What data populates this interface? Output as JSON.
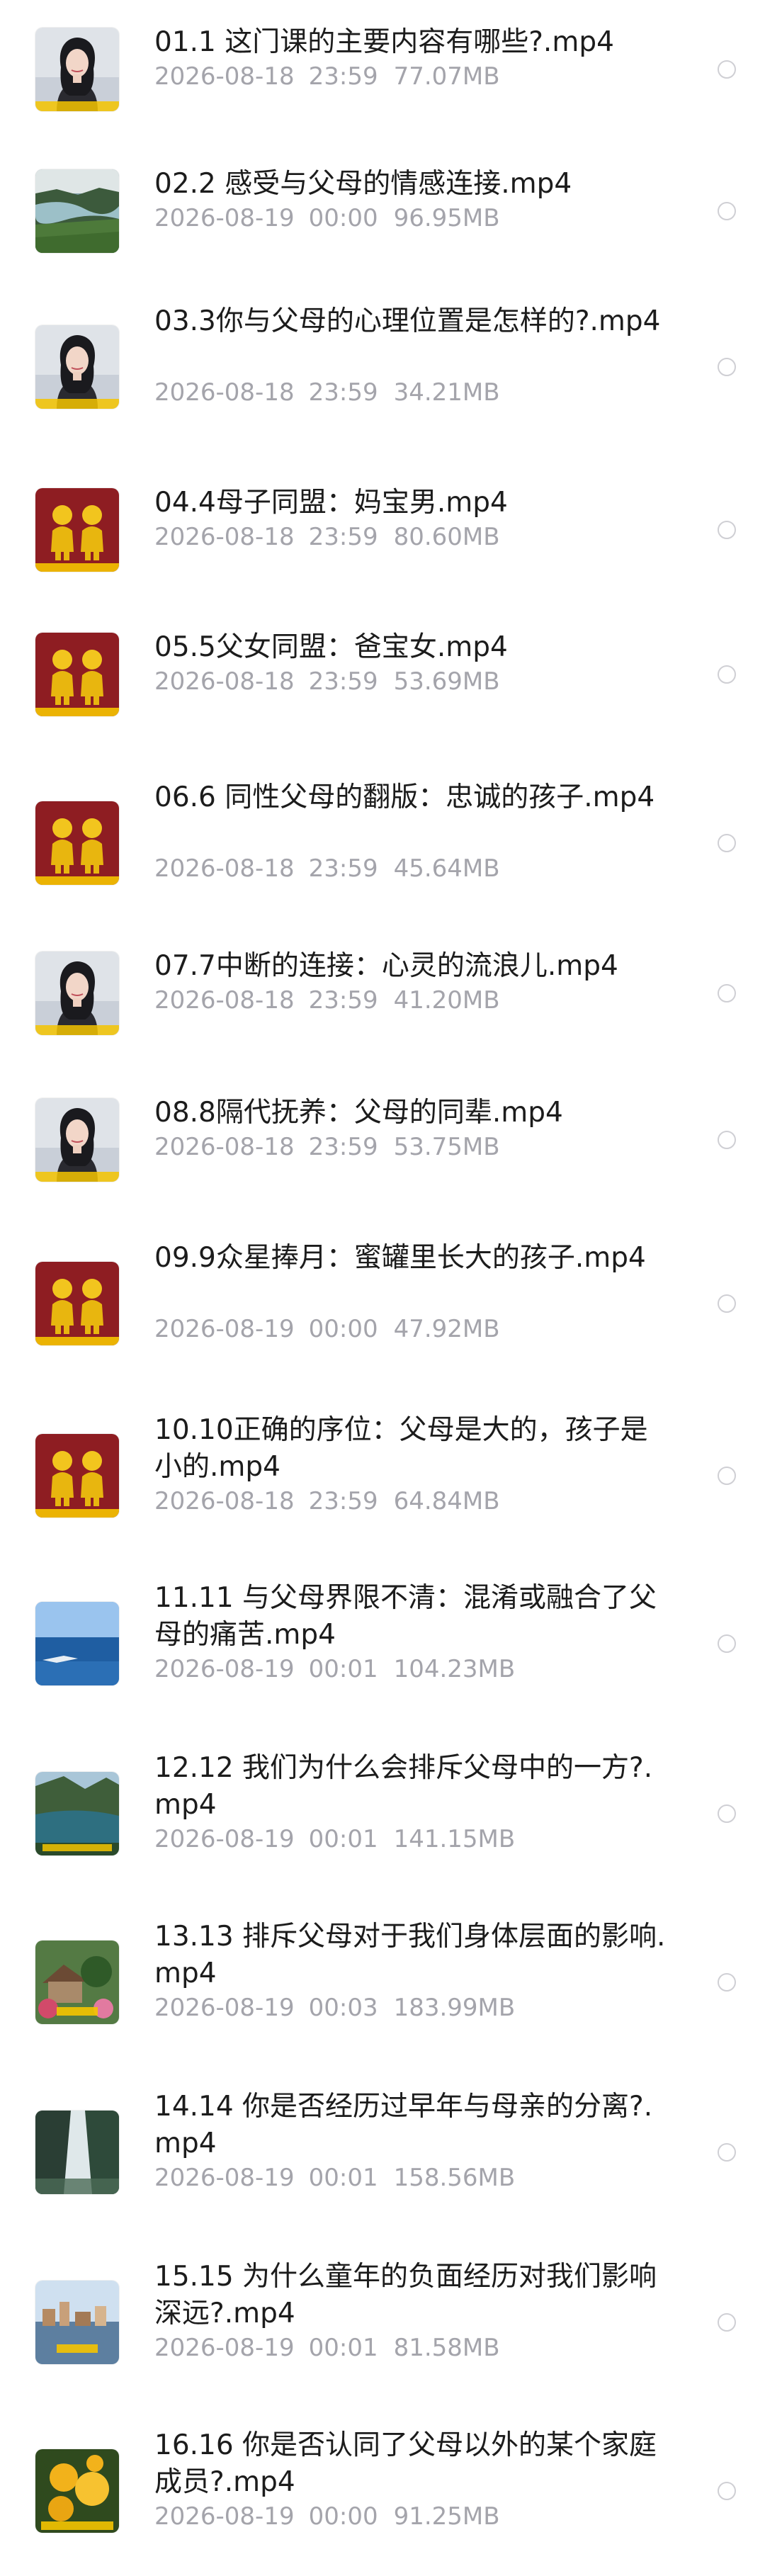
{
  "files": [
    {
      "name": "01.1 这门课的主要内容有哪些?.mp4",
      "date": "2026-08-18",
      "time": "23:59",
      "size": "77.07MB",
      "thumb": "woman-portrait-icon"
    },
    {
      "name": "02.2 感受与父母的情感连接.mp4",
      "date": "2026-08-19",
      "time": "00:00",
      "size": "96.95MB",
      "thumb": "landscape-icon"
    },
    {
      "name": "03.3你与父母的心理位置是怎样的?.mp4",
      "date": "2026-08-18",
      "time": "23:59",
      "size": "34.21MB",
      "thumb": "woman-portrait-icon"
    },
    {
      "name": "04.4母子同盟：妈宝男.mp4",
      "date": "2026-08-18",
      "time": "23:59",
      "size": "80.60MB",
      "thumb": "figurines-icon"
    },
    {
      "name": "05.5父女同盟：爸宝女.mp4",
      "date": "2026-08-18",
      "time": "23:59",
      "size": "53.69MB",
      "thumb": "figurines-icon"
    },
    {
      "name": "06.6 同性父母的翻版：忠诚的孩子.mp4",
      "date": "2026-08-18",
      "time": "23:59",
      "size": "45.64MB",
      "thumb": "figurines-icon"
    },
    {
      "name": "07.7中断的连接：心灵的流浪儿.mp4",
      "date": "2026-08-18",
      "time": "23:59",
      "size": "41.20MB",
      "thumb": "woman-portrait-icon"
    },
    {
      "name": "08.8隔代抚养：父母的同辈.mp4",
      "date": "2026-08-18",
      "time": "23:59",
      "size": "53.75MB",
      "thumb": "woman-portrait-icon"
    },
    {
      "name": "09.9众星捧月：蜜罐里长大的孩子.mp4",
      "date": "2026-08-19",
      "time": "00:00",
      "size": "47.92MB",
      "thumb": "figurines-icon"
    },
    {
      "name": "10.10正确的序位：父母是大的，孩子是小的.mp4",
      "date": "2026-08-18",
      "time": "23:59",
      "size": "64.84MB",
      "thumb": "figurines-icon"
    },
    {
      "name": "11.11 与父母界限不清：混淆或融合了父母的痛苦.mp4",
      "date": "2026-08-19",
      "time": "00:01",
      "size": "104.23MB",
      "thumb": "sea-icon"
    },
    {
      "name": "12.12 我们为什么会排斥父母中的一方?.mp4",
      "date": "2026-08-19",
      "time": "00:01",
      "size": "141.15MB",
      "thumb": "lake-icon"
    },
    {
      "name": "13.13 排斥父母对于我们身体层面的影响.mp4",
      "date": "2026-08-19",
      "time": "00:03",
      "size": "183.99MB",
      "thumb": "garden-icon"
    },
    {
      "name": "14.14 你是否经历过早年与母亲的分离?.mp4",
      "date": "2026-08-19",
      "time": "00:01",
      "size": "158.56MB",
      "thumb": "waterfall-icon"
    },
    {
      "name": "15.15 为什么童年的负面经历对我们影响深远?.mp4",
      "date": "2026-08-19",
      "time": "00:01",
      "size": "81.58MB",
      "thumb": "town-icon"
    },
    {
      "name": "16.16 你是否认同了父母以外的某个家庭成员?.mp4",
      "date": "2026-08-19",
      "time": "00:00",
      "size": "91.25MB",
      "thumb": "flower-icon"
    }
  ]
}
